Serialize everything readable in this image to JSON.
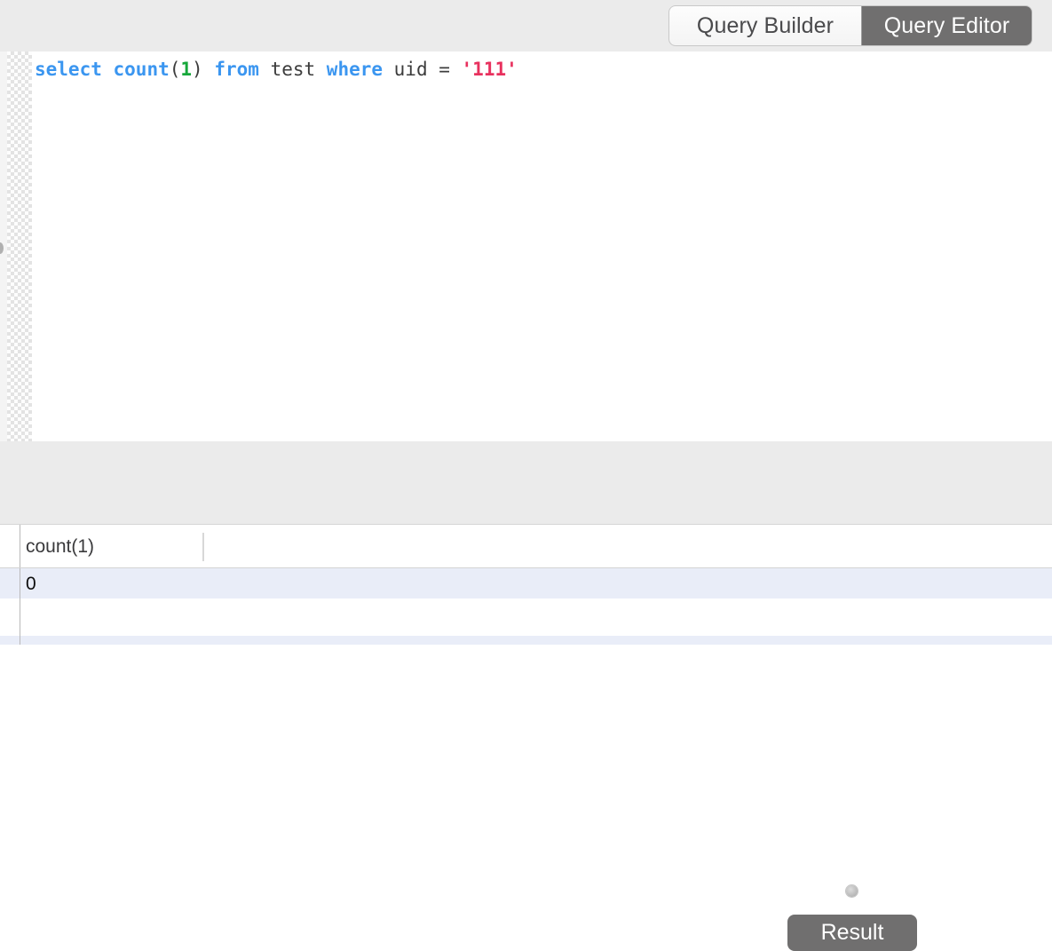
{
  "toolbar": {
    "tabs": [
      {
        "label": "Query Builder",
        "state": "inactive"
      },
      {
        "label": "Query Editor",
        "state": "active"
      }
    ]
  },
  "editor": {
    "query_text": "select count(1) from test where uid = '111'",
    "tokens": [
      {
        "text": "select",
        "type": "keyword"
      },
      {
        "text": " ",
        "type": "plain"
      },
      {
        "text": "count",
        "type": "keyword"
      },
      {
        "text": "(",
        "type": "punct"
      },
      {
        "text": "1",
        "type": "number"
      },
      {
        "text": ")",
        "type": "punct"
      },
      {
        "text": " ",
        "type": "plain"
      },
      {
        "text": "from",
        "type": "keyword"
      },
      {
        "text": " test ",
        "type": "plain"
      },
      {
        "text": "where",
        "type": "keyword"
      },
      {
        "text": " uid = ",
        "type": "plain"
      },
      {
        "text": "'111'",
        "type": "string"
      }
    ],
    "colors": {
      "keyword": "#3b96f0",
      "number": "#17a83b",
      "string": "#e8315e",
      "plain": "#3c3c3c"
    }
  },
  "panel": {
    "result_button_label": "Result"
  },
  "result_table": {
    "columns": [
      "count(1)",
      ""
    ],
    "rows": [
      [
        "0",
        ""
      ],
      [
        "",
        ""
      ],
      [
        "",
        ""
      ]
    ]
  }
}
